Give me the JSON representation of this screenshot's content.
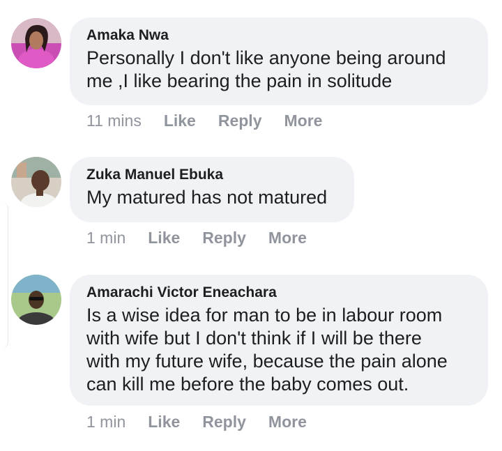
{
  "comments": [
    {
      "author": "Amaka Nwa",
      "lines": [
        "Personally I don't like anyone being around",
        "me ,I like bearing the pain in solitude"
      ],
      "time": "11 mins",
      "like": "Like",
      "reply": "Reply",
      "more": "More",
      "avatar_icon": "profile-photo-woman-pink"
    },
    {
      "author": "Zuka Manuel Ebuka",
      "lines": [
        "My matured has not matured"
      ],
      "time": "1 min",
      "like": "Like",
      "reply": "Reply",
      "more": "More",
      "avatar_icon": "profile-photo-man"
    },
    {
      "author": "Amarachi Victor Eneachara",
      "lines": [
        "Is a wise idea for man to be in labour room",
        "with wife but I don't think if I will be there",
        "with my future wife, because the pain alone",
        "can kill me before the baby comes out."
      ],
      "time": "1 min",
      "like": "Like",
      "reply": "Reply",
      "more": "More",
      "avatar_icon": "profile-photo-man-sunglasses"
    }
  ],
  "colors": {
    "bubble_bg": "#f0f2f5",
    "text": "#1c1e21",
    "meta": "#90949c"
  }
}
